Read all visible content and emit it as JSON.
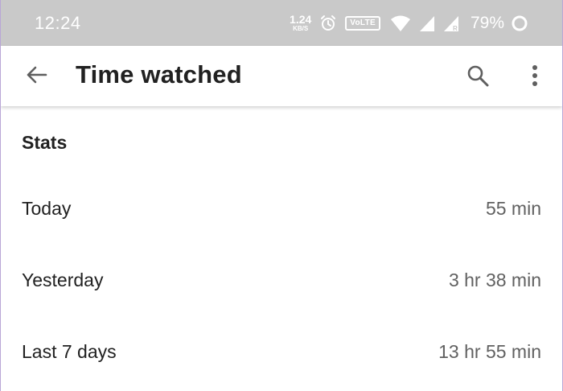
{
  "status_bar": {
    "time": "12:24",
    "net_speed_value": "1.24",
    "net_speed_unit": "KB/S",
    "volte_label": "VoLTE",
    "battery_percent": "79%",
    "icons": [
      "alarm-icon",
      "volte-icon",
      "wifi-icon",
      "signal-icon",
      "signal-roaming-icon",
      "battery-circle-icon"
    ],
    "background_color": "#c9c9c9"
  },
  "app_bar": {
    "title": "Time watched",
    "icons": [
      "back-arrow-icon",
      "search-icon",
      "more-vert-icon"
    ]
  },
  "stats": {
    "header": "Stats",
    "rows": [
      {
        "label": "Today",
        "value": "55 min"
      },
      {
        "label": "Yesterday",
        "value": "3 hr 38 min"
      },
      {
        "label": "Last 7 days",
        "value": "13 hr 55 min"
      }
    ]
  }
}
